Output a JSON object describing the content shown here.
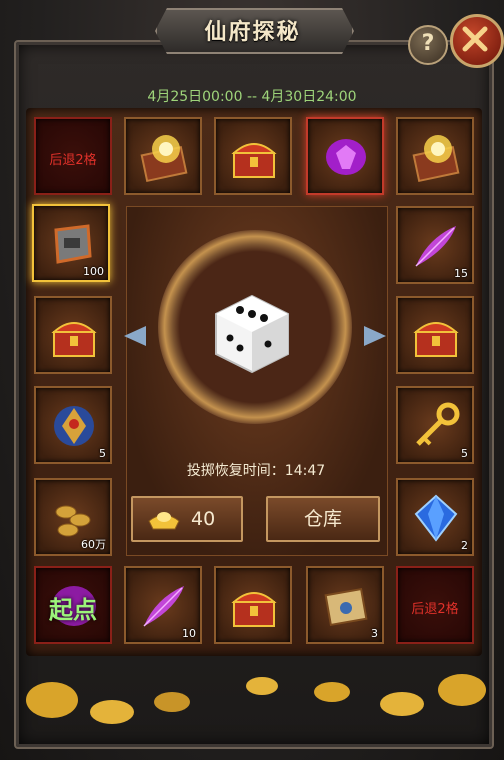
{
  "title": "仙府探秘",
  "help_label": "?",
  "event_dates": "4月25日00:00 -- 4月30日24:00",
  "tiles": {
    "top_left": "后退2格",
    "bottom_left": "起点",
    "bottom_right": "后退2格"
  },
  "counts": {
    "armor": "100",
    "feather_right": "15",
    "amulet": "5",
    "key": "5",
    "coins": "60万",
    "gem": "2",
    "feather_bottom": "10",
    "scroll": "3"
  },
  "timer_text": "投掷恢复时间：14:47",
  "gold_count": "40",
  "warehouse_label": "仓库",
  "colors": {
    "accent_green": "#9ed47a",
    "warning_red": "#e0312a",
    "gold_highlight": "#f2c23a"
  }
}
